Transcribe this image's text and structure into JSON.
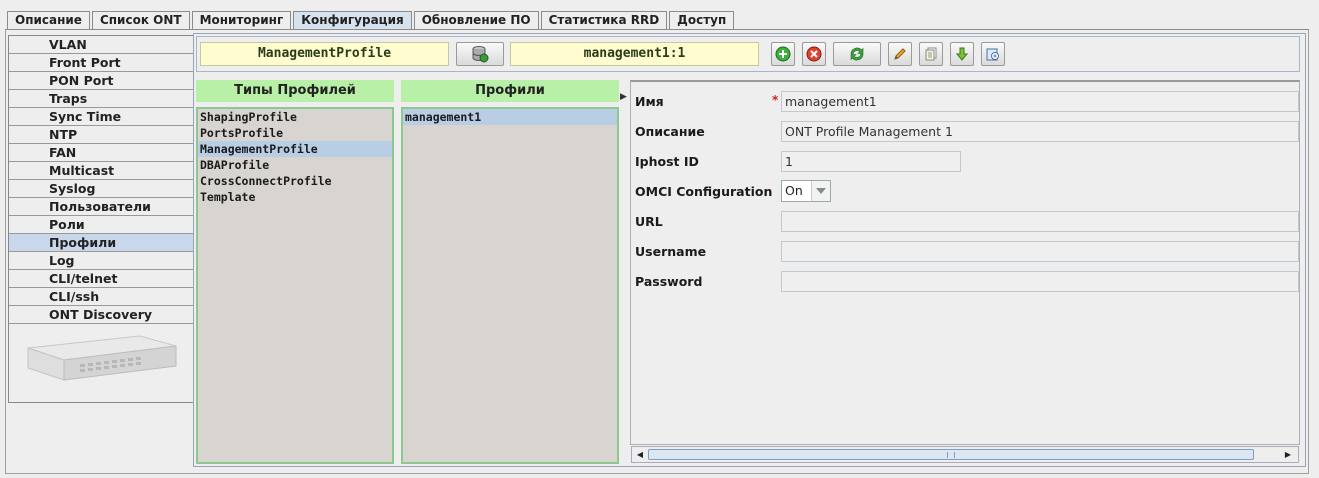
{
  "tabs": [
    "Описание",
    "Список ONT",
    "Мониторинг",
    "Конфигурация",
    "Обновление ПО",
    "Статистика RRD",
    "Доступ"
  ],
  "active_tab": "Конфигурация",
  "sidebar": {
    "items": [
      "VLAN",
      "Front Port",
      "PON Port",
      "Traps",
      "Sync Time",
      "NTP",
      "FAN",
      "Multicast",
      "Syslog",
      "Пользователи",
      "Роли",
      "Профили",
      "Log",
      "CLI/telnet",
      "CLI/ssh",
      "ONT Discovery"
    ],
    "active": "Профили"
  },
  "toolbar": {
    "profile_type": "ManagementProfile",
    "profile_name": "management1:1",
    "buttons": [
      "db-icon",
      "add-icon",
      "delete-icon",
      "refresh-icon",
      "edit-icon",
      "copy-icon",
      "download-icon",
      "export-icon"
    ]
  },
  "profile_types": {
    "header": "Типы Профилей",
    "items": [
      "ShapingProfile",
      "PortsProfile",
      "ManagementProfile",
      "DBAProfile",
      "CrossConnectProfile",
      "Template"
    ],
    "selected": "ManagementProfile"
  },
  "profiles": {
    "header": "Профили",
    "items": [
      "management1"
    ],
    "selected": "management1"
  },
  "form": {
    "name_label": "Имя",
    "name_required_mark": "*",
    "name_value": "management1",
    "description_label": "Описание",
    "description_value": "ONT Profile Management 1",
    "iphost_label": "Iphost ID",
    "iphost_value": "1",
    "omci_label": "OMCI Configuration",
    "omci_value": "On",
    "url_label": "URL",
    "url_value": "",
    "username_label": "Username",
    "username_value": "",
    "password_label": "Password",
    "password_value": ""
  },
  "colors": {
    "list_header": "#b8f0a8",
    "field_bg": "#fffdd0",
    "selection": "#b9cde5",
    "required": "#d02020"
  }
}
